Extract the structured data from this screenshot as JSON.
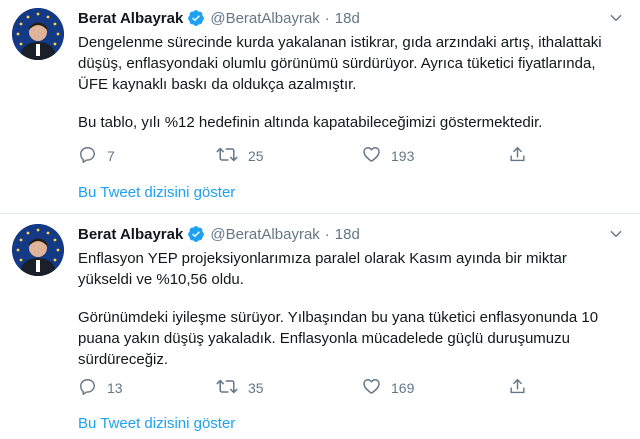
{
  "tweets": [
    {
      "name": "Berat Albayrak",
      "handle": "@BeratAlbayrak",
      "time": "18d",
      "paragraphs": [
        "Dengelenme sürecinde kurda yakalanan istikrar, gıda arzındaki artış, ithalattaki düşüş, enflasyondaki olumlu görünümü sürdürüyor. Ayrıca tüketici fiyatlarında, ÜFE kaynaklı baskı da oldukça azalmıştır.",
        "Bu tablo, yılı %12 hedefinin altında kapatabileceğimizi göstermektedir."
      ],
      "replies": "7",
      "retweets": "25",
      "likes": "193",
      "show_thread": "Bu Tweet dizisini göster"
    },
    {
      "name": "Berat Albayrak",
      "handle": "@BeratAlbayrak",
      "time": "18d",
      "paragraphs": [
        "Enflasyon YEP projeksiyonlarımıza paralel olarak Kasım ayında bir miktar yükseldi ve %10,56 oldu.",
        "Görünümdeki iyileşme sürüyor. Yılbaşından bu yana tüketici enflasyonunda 10 puana yakın düşüş yakaladık. Enflasyonla mücadelede güçlü duruşumuzu sürdüreceğiz."
      ],
      "replies": "13",
      "retweets": "35",
      "likes": "169",
      "show_thread": "Bu Tweet dizisini göster"
    }
  ],
  "icons": {
    "reply": "reply-icon",
    "retweet": "retweet-icon",
    "like": "heart-icon",
    "share": "share-icon",
    "verified": "verified-badge-icon",
    "caret": "chevron-down-icon"
  },
  "colors": {
    "accent": "#1da1f2",
    "muted": "#657786",
    "text": "#14171a",
    "border": "#e6ecf0"
  }
}
